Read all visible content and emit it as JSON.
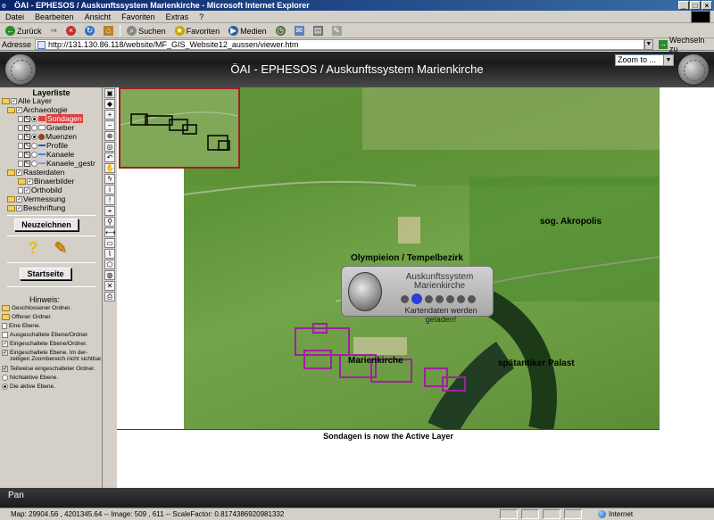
{
  "window": {
    "title": "ÖAI - EPHESOS / Auskunftssystem Marienkirche - Microsoft Internet Explorer"
  },
  "menu": [
    "Datei",
    "Bearbeiten",
    "Ansicht",
    "Favoriten",
    "Extras",
    "?"
  ],
  "toolbar": {
    "back": "Zurück",
    "search": "Suchen",
    "favorites": "Favoriten",
    "media": "Medien"
  },
  "address": {
    "label": "Adresse",
    "url": "http://131.130.86.118/website/MF_GIS_Website12_aussen/viewer.htm",
    "go": "Wechseln zu"
  },
  "app": {
    "title": "ÖAI - EPHESOS / Auskunftssystem Marienkirche",
    "zoom_select": "Zoom to ..."
  },
  "layers": {
    "title": "Layerliste",
    "items": [
      {
        "label": "Alle Layer"
      },
      {
        "label": "Archaeologie"
      },
      {
        "label": "Sondagen",
        "color": "#e04040"
      },
      {
        "label": "Graeber",
        "color": "#ffffff"
      },
      {
        "label": "Muenzen",
        "color": "#8b4513"
      },
      {
        "label": "Profile",
        "color": "#3050d0"
      },
      {
        "label": "Kanaele",
        "color": "#4080ff"
      },
      {
        "label": "Kanaele_gestr",
        "color": "#9090ff"
      },
      {
        "label": "Rasterdaten"
      },
      {
        "label": "Binaerbilder"
      },
      {
        "label": "Orthobild"
      },
      {
        "label": "Vermessung"
      },
      {
        "label": "Beschriftung"
      }
    ]
  },
  "buttons": {
    "redraw": "Neuzeichnen",
    "home": "Startseite"
  },
  "legend": {
    "title": "Hinweis:",
    "items": [
      "Geschlossener Ordner.",
      "Offener Ordner.",
      "Eine Ebene.",
      "Ausgeschaltete Ebene/Ordner.",
      "Eingeschaltete Ebene/Ordner.",
      "Eingeschaltete Ebene. Im der-zeitigen Zoombereich nicht sichtbar.",
      "Teilweise eingeschalteter Ordner.",
      "Nichtaktive Ebene.",
      "Die aktive Ebene."
    ]
  },
  "map": {
    "labels": [
      "sog. Akropolis",
      "Olympieion / Tempelbezirk",
      "Marienkirche",
      "spätantiker Palast"
    ],
    "loading": {
      "line1": "Auskunftssystem",
      "line2": "Marienkirche",
      "message": "Kartendaten werden geladen!"
    }
  },
  "active_layer_message": "Sondagen is now the Active Layer",
  "mode": "Pan",
  "status": {
    "text": "Map: 29904.56 , 4201345.64 -- Image: 509 , 611 -- ScaleFactor: 0.8174386920981332",
    "zone": "Internet"
  }
}
